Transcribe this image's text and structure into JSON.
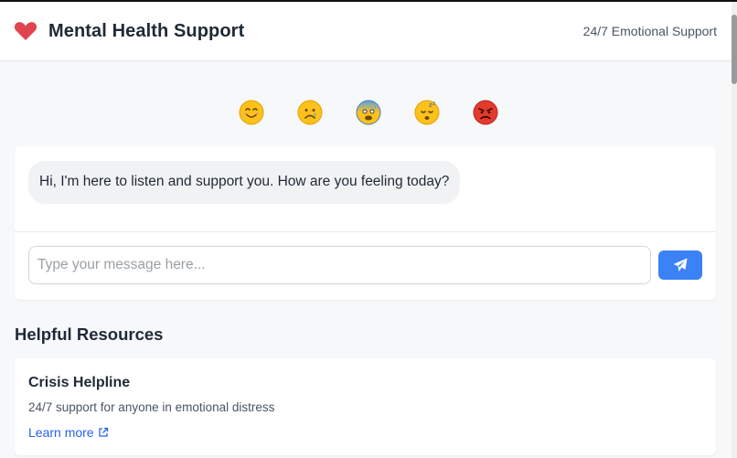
{
  "header": {
    "title": "Mental Health Support",
    "subtitle": "24/7 Emotional Support",
    "icon": "heart-icon",
    "accent": "#e0454f"
  },
  "moods": [
    {
      "name": "happy",
      "emoji": "😊"
    },
    {
      "name": "sad",
      "emoji": "😢"
    },
    {
      "name": "anxious",
      "emoji": "😰"
    },
    {
      "name": "tired",
      "emoji": "😴"
    },
    {
      "name": "angry",
      "emoji": "😡"
    }
  ],
  "chat": {
    "messages": [
      {
        "from": "bot",
        "text": "Hi, I'm here to listen and support you. How are you feeling today?"
      }
    ],
    "input_placeholder": "Type your message here...",
    "input_value": "",
    "send_icon": "paper-plane-icon",
    "send_color": "#3b82f6"
  },
  "resources": {
    "title": "Helpful Resources",
    "items": [
      {
        "name": "Crisis Helpline",
        "description": "24/7 support for anyone in emotional distress",
        "link_label": "Learn more",
        "link_icon": "external-link-icon"
      }
    ]
  }
}
